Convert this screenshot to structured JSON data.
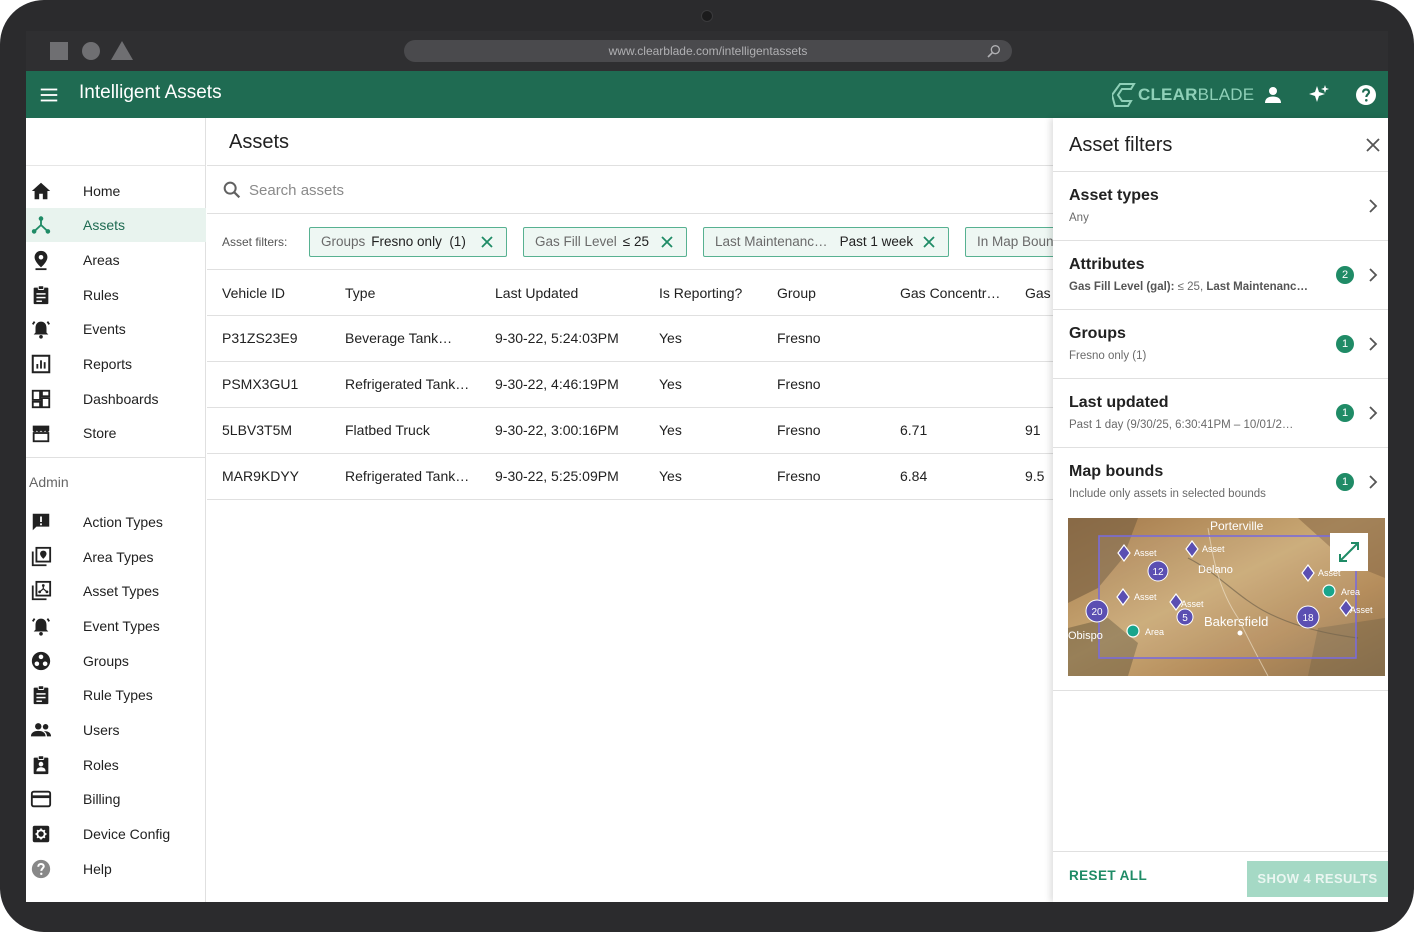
{
  "browser": {
    "url": "www.clearblade.com/intelligentassets"
  },
  "appbar": {
    "title": "Intelligent Assets",
    "brand": "CLEAR",
    "brand2": "BLADE",
    "accent": "#1f6b52"
  },
  "sidebar": {
    "items": [
      {
        "label": "Home",
        "icon": "home-icon"
      },
      {
        "label": "Assets",
        "icon": "assets-icon",
        "active": true
      },
      {
        "label": "Areas",
        "icon": "location-pin-icon"
      },
      {
        "label": "Rules",
        "icon": "clipboard-icon"
      },
      {
        "label": "Events",
        "icon": "alarm-bell-icon"
      },
      {
        "label": "Reports",
        "icon": "report-chart-icon"
      },
      {
        "label": "Dashboards",
        "icon": "dashboard-icon"
      },
      {
        "label": "Store",
        "icon": "store-icon"
      }
    ],
    "admin_label": "Admin",
    "admin_items": [
      {
        "label": "Action Types",
        "icon": "alert-message-icon"
      },
      {
        "label": "Area Types",
        "icon": "area-types-icon"
      },
      {
        "label": "Asset Types",
        "icon": "asset-types-icon"
      },
      {
        "label": "Event Types",
        "icon": "alarm-bell-icon"
      },
      {
        "label": "Groups",
        "icon": "groups-icon"
      },
      {
        "label": "Rule Types",
        "icon": "clipboard-icon"
      },
      {
        "label": "Users",
        "icon": "users-icon"
      },
      {
        "label": "Roles",
        "icon": "roles-icon"
      },
      {
        "label": "Billing",
        "icon": "credit-card-icon"
      },
      {
        "label": "Device Config",
        "icon": "device-config-icon"
      },
      {
        "label": "Help",
        "icon": "help-circle-icon"
      }
    ]
  },
  "main": {
    "title": "Assets",
    "search_placeholder": "Search assets",
    "filters_label": "Asset filters:",
    "chips": [
      {
        "key": "Groups",
        "value": "Fresno only  (1)"
      },
      {
        "key": "Gas Fill Level",
        "value": "≤ 25"
      },
      {
        "key": "Last Maintenanc…",
        "value": "Past 1 week"
      },
      {
        "key": "In Map Boun",
        "value": ""
      }
    ],
    "columns": [
      "Vehicle ID",
      "Type",
      "Last Updated",
      "Is Reporting?",
      "Group",
      "Gas Concentr…",
      "Gas l"
    ],
    "rows": [
      [
        "P31ZS23E9",
        "Beverage Tank…",
        "9-30-22, 5:24:03PM",
        "Yes",
        "Fresno",
        "",
        ""
      ],
      [
        "PSMX3GU1",
        "Refrigerated Tank…",
        "9-30-22, 4:46:19PM",
        "Yes",
        "Fresno",
        "",
        ""
      ],
      [
        "5LBV3T5M",
        "Flatbed Truck",
        "9-30-22, 3:00:16PM",
        "Yes",
        "Fresno",
        "6.71",
        "91"
      ],
      [
        "MAR9KDYY",
        "Refrigerated Tank…",
        "9-30-22, 5:25:09PM",
        "Yes",
        "Fresno",
        "6.84",
        "9.5"
      ]
    ]
  },
  "panel": {
    "title": "Asset filters",
    "sections": [
      {
        "title": "Asset types",
        "sub": "Any",
        "badge": ""
      },
      {
        "title": "Attributes",
        "sub_bold1": "Gas Fill Level (gal):",
        "sub_mid": " ≤ 25, ",
        "sub_bold2": "Last Maintenanc…",
        "badge": "2"
      },
      {
        "title": "Groups",
        "sub": "Fresno only (1)",
        "badge": "1"
      },
      {
        "title": "Last updated",
        "sub": "Past 1 day (9/30/25, 6:30:41PM – 10/01/2…",
        "badge": "1"
      },
      {
        "title": "Map bounds",
        "sub": "Include only assets in selected bounds",
        "badge": "1"
      }
    ],
    "map": {
      "cities": [
        "Porterville",
        "Delano",
        "Bakersfield",
        "Obispo"
      ],
      "markers": [
        {
          "label": "Asset",
          "kind": "asset"
        },
        {
          "label": "Asset",
          "kind": "asset"
        },
        {
          "label": "Asset",
          "kind": "asset"
        },
        {
          "label": "Asset",
          "kind": "asset"
        },
        {
          "label": "Asset",
          "kind": "asset"
        },
        {
          "label": "Asset",
          "kind": "asset"
        },
        {
          "label": "Area",
          "kind": "area"
        },
        {
          "label": "Area",
          "kind": "area"
        }
      ],
      "clusters": [
        "12",
        "20",
        "5",
        "18"
      ]
    },
    "reset_label": "RESET ALL",
    "show_label": "SHOW 4 RESULTS"
  }
}
